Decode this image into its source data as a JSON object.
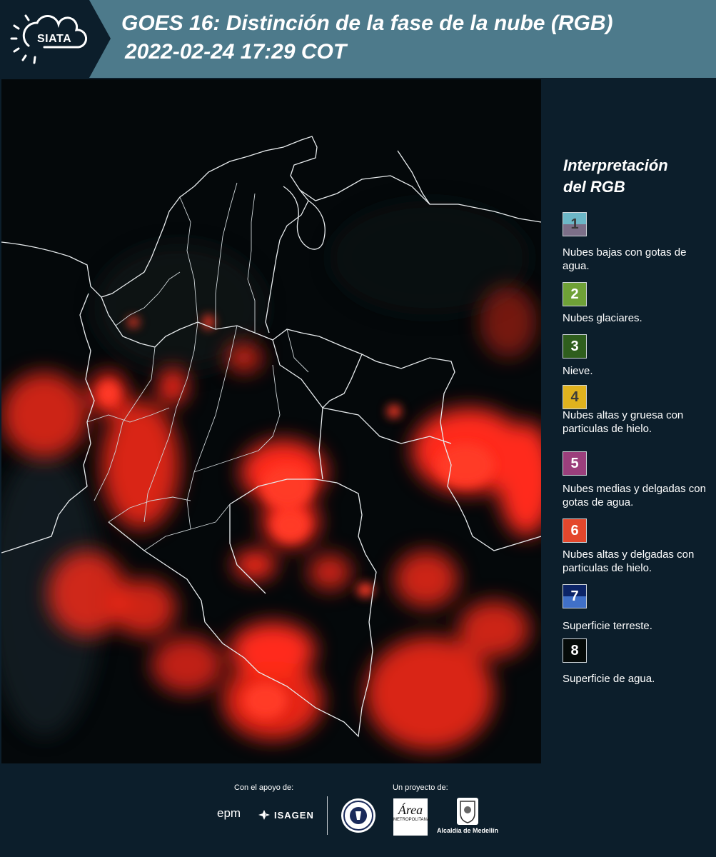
{
  "header": {
    "logo_text": "SIATA",
    "title_line1": "GOES 16: Distinción de la fase de la nube (RGB)",
    "title_line2": "2022-02-24 17:29 COT"
  },
  "legend": {
    "title_line1": "Interpretación",
    "title_line2": "del RGB",
    "items": [
      {
        "num": "1",
        "color_top": "#6cb7c7",
        "color_bottom": "#7c6f88",
        "label": "Nubes bajas con gotas de agua."
      },
      {
        "num": "2",
        "color_top": "#6fa137",
        "color_bottom": "#6fa137",
        "label": "Nubes glaciares."
      },
      {
        "num": "3",
        "color_top": "#2f5e1d",
        "color_bottom": "#2f5e1d",
        "label": "Nieve."
      },
      {
        "num": "4",
        "color_top": "#e0b21e",
        "color_bottom": "#e0b21e",
        "label": "Nubes altas y gruesa con particulas de hielo."
      },
      {
        "num": "5",
        "color_top": "#9b3f7c",
        "color_bottom": "#9b3f7c",
        "label": "Nubes medias y delgadas con gotas de agua."
      },
      {
        "num": "6",
        "color_top": "#e4472c",
        "color_bottom": "#e4472c",
        "label": "Nubes altas y delgadas con particulas de hielo."
      },
      {
        "num": "7",
        "color_top": "#0c2467",
        "color_bottom": "#4070c8",
        "label": "Superficie terreste."
      },
      {
        "num": "8",
        "color_top": "#050a08",
        "color_bottom": "#050a08",
        "label": "Superficie de agua."
      }
    ]
  },
  "footer": {
    "support_label": "Con el apoyo de:",
    "project_label": "Un proyecto de:",
    "sponsor1": "epm",
    "sponsor2": "ISAGEN",
    "area_logo_text": "Área",
    "area_logo_sub": "METROPOLITANA",
    "alcaldia": "Alcaldía de Medellín"
  },
  "colors": {
    "header_bg": "#4d7a8b",
    "panel_bg": "#0c1e2b",
    "cloud_red": "#ff2a1a"
  }
}
